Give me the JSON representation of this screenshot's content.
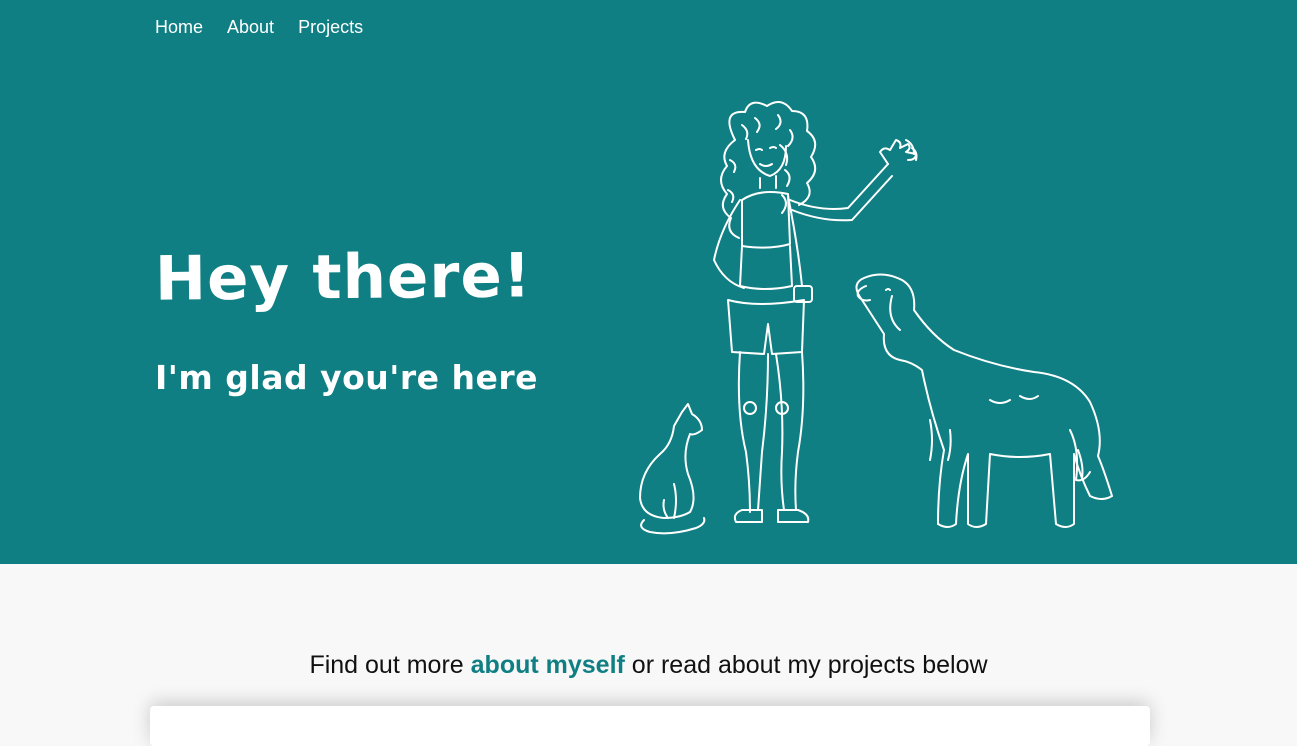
{
  "nav": {
    "items": [
      {
        "label": "Home"
      },
      {
        "label": "About"
      },
      {
        "label": "Projects"
      }
    ]
  },
  "hero": {
    "title": "Hey there!",
    "subtitle": "I'm glad you're here",
    "background_color": "#0f7f83",
    "illustration_icon": "girl-waving-with-cat-and-dog-illustration"
  },
  "intro": {
    "prefix": "Find out more ",
    "link_label": "about myself",
    "suffix": " or read about my projects below",
    "link_color": "#0f7f83"
  }
}
